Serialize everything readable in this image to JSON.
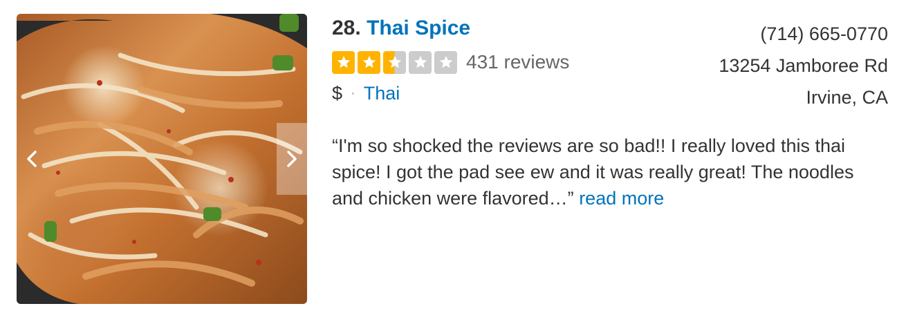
{
  "business": {
    "rank": "28.",
    "name": "Thai Spice",
    "rating": 2.5,
    "rating_max": 5,
    "review_count": "431 reviews",
    "price": "$",
    "separator": "·",
    "category": "Thai",
    "phone": "(714) 665-0770",
    "address_line1": "13254 Jamboree Rd",
    "address_line2": "Irvine, CA",
    "snippet": "“I'm so shocked the reviews are so bad!! I really loved this thai spice! I got the pad see ew and it was really great! The noodles and chicken were flavored…”",
    "read_more": "read more"
  },
  "colors": {
    "link": "#0073bb",
    "star_filled": "#ffb300",
    "star_empty": "#cccccc",
    "text": "#333333",
    "muted": "#666666"
  },
  "icons": {
    "prev": "chevron-left-icon",
    "next": "chevron-right-icon",
    "star": "star-icon"
  }
}
